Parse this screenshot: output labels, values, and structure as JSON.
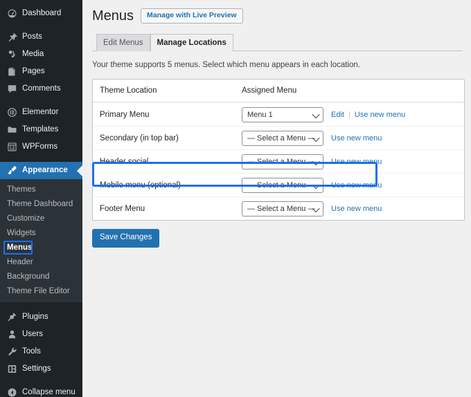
{
  "sidebar": {
    "items": [
      {
        "label": "Dashboard",
        "icon": "dashboard-icon",
        "active": false
      },
      {
        "label": "Posts",
        "icon": "pin-icon",
        "active": false
      },
      {
        "label": "Media",
        "icon": "media-icon",
        "active": false
      },
      {
        "label": "Pages",
        "icon": "pages-icon",
        "active": false
      },
      {
        "label": "Comments",
        "icon": "comments-icon",
        "active": false
      },
      {
        "label": "Elementor",
        "icon": "elementor-icon",
        "active": false
      },
      {
        "label": "Templates",
        "icon": "folder-icon",
        "active": false
      },
      {
        "label": "WPForms",
        "icon": "wpforms-icon",
        "active": false
      },
      {
        "label": "Appearance",
        "icon": "brush-icon",
        "active": true
      }
    ],
    "submenu": [
      {
        "label": "Themes",
        "current": false
      },
      {
        "label": "Theme Dashboard",
        "current": false
      },
      {
        "label": "Customize",
        "current": false
      },
      {
        "label": "Widgets",
        "current": false
      },
      {
        "label": "Menus",
        "current": true
      },
      {
        "label": "Header",
        "current": false
      },
      {
        "label": "Background",
        "current": false
      },
      {
        "label": "Theme File Editor",
        "current": false
      }
    ],
    "bottom_items": [
      {
        "label": "Plugins",
        "icon": "plugins-icon"
      },
      {
        "label": "Users",
        "icon": "users-icon"
      },
      {
        "label": "Tools",
        "icon": "wrench-icon"
      },
      {
        "label": "Settings",
        "icon": "settings-icon"
      },
      {
        "label": "Collapse menu",
        "icon": "collapse-icon"
      }
    ],
    "colors": {
      "background": "#1d2327",
      "submenu_background": "#2c3338",
      "active": "#2271b1",
      "highlight": "#1a6ef5"
    }
  },
  "header": {
    "title": "Menus",
    "live_preview_label": "Manage with Live Preview"
  },
  "tabs": [
    {
      "label": "Edit Menus",
      "active": false
    },
    {
      "label": "Manage Locations",
      "active": true
    }
  ],
  "intro_text": "Your theme supports 5 menus. Select which menu appears in each location.",
  "table": {
    "headers": {
      "location": "Theme Location",
      "assigned": "Assigned Menu"
    },
    "rows": [
      {
        "location": "Primary Menu",
        "selected": "Menu 1",
        "select_width": "wide",
        "edit_label": "Edit",
        "use_new_label": "Use new menu",
        "highlighted": false
      },
      {
        "location": "Secondary (in top bar)",
        "selected": "— Select a Menu —",
        "select_width": "narrow",
        "edit_label": "",
        "use_new_label": "Use new menu",
        "highlighted": false
      },
      {
        "location": "Header social",
        "selected": "— Select a Menu —",
        "select_width": "narrow",
        "edit_label": "",
        "use_new_label": "Use new menu",
        "highlighted": false
      },
      {
        "location": "Mobile menu (optional)",
        "selected": "— Select a Menu —",
        "select_width": "narrow",
        "edit_label": "",
        "use_new_label": "Use new menu",
        "highlighted": true
      },
      {
        "location": "Footer Menu",
        "selected": "— Select a Menu —",
        "select_width": "narrow",
        "edit_label": "",
        "use_new_label": "Use new menu",
        "highlighted": false
      }
    ]
  },
  "save_label": "Save Changes"
}
